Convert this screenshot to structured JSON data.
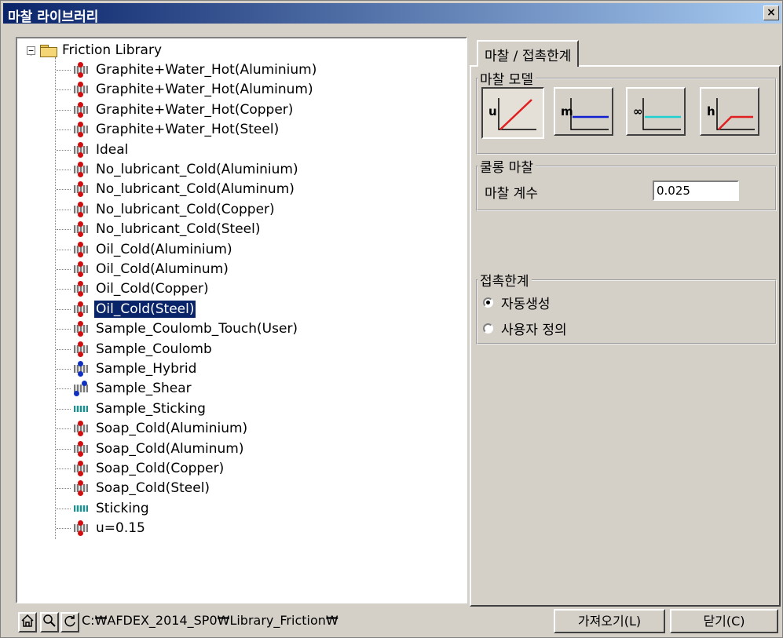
{
  "window": {
    "title": "마찰 라이브러리",
    "close_glyph": "×"
  },
  "tree": {
    "root_label": "Friction Library",
    "expander_glyph": "−",
    "items": [
      {
        "label": "Graphite+Water_Hot(Aluminium)",
        "icon": "red-grid-icon"
      },
      {
        "label": "Graphite+Water_Hot(Aluminum)",
        "icon": "red-grid-icon"
      },
      {
        "label": "Graphite+Water_Hot(Copper)",
        "icon": "red-grid-icon"
      },
      {
        "label": "Graphite+Water_Hot(Steel)",
        "icon": "red-grid-icon"
      },
      {
        "label": "Ideal",
        "icon": "red-grid-icon"
      },
      {
        "label": "No_lubricant_Cold(Aluminium)",
        "icon": "red-grid-icon"
      },
      {
        "label": "No_lubricant_Cold(Aluminum)",
        "icon": "red-grid-icon"
      },
      {
        "label": "No_lubricant_Cold(Copper)",
        "icon": "red-grid-icon"
      },
      {
        "label": "No_lubricant_Cold(Steel)",
        "icon": "red-grid-icon"
      },
      {
        "label": "Oil_Cold(Aluminium)",
        "icon": "red-grid-icon"
      },
      {
        "label": "Oil_Cold(Aluminum)",
        "icon": "red-grid-icon"
      },
      {
        "label": "Oil_Cold(Copper)",
        "icon": "red-grid-icon"
      },
      {
        "label": "Oil_Cold(Steel)",
        "icon": "red-grid-icon",
        "selected": true
      },
      {
        "label": "Sample_Coulomb_Touch(User)",
        "icon": "red-grid-icon"
      },
      {
        "label": "Sample_Coulomb",
        "icon": "red-grid-icon"
      },
      {
        "label": "Sample_Hybrid",
        "icon": "hybrid-grid-icon"
      },
      {
        "label": "Sample_Shear",
        "icon": "shear-grid-icon"
      },
      {
        "label": "Sample_Sticking",
        "icon": "sticking-grid-icon"
      },
      {
        "label": "Soap_Cold(Aluminium)",
        "icon": "red-grid-icon"
      },
      {
        "label": "Soap_Cold(Aluminum)",
        "icon": "red-grid-icon"
      },
      {
        "label": "Soap_Cold(Copper)",
        "icon": "red-grid-icon"
      },
      {
        "label": "Soap_Cold(Steel)",
        "icon": "red-grid-icon"
      },
      {
        "label": "Sticking",
        "icon": "sticking-grid-icon"
      },
      {
        "label": "u=0.15",
        "icon": "red-grid-icon"
      }
    ]
  },
  "tab": {
    "label": "마찰 / 접촉한계"
  },
  "friction_model": {
    "legend": "마찰 모델",
    "buttons": [
      {
        "label": "u",
        "line_color": "#e02020",
        "active": true
      },
      {
        "label": "m",
        "line_color": "#1020d0",
        "active": false
      },
      {
        "label": "∞",
        "line_color": "#20d0d0",
        "active": false
      },
      {
        "label": "h",
        "line_color": "#e02020",
        "active": false
      }
    ]
  },
  "coulomb": {
    "legend": "쿨롱 마찰",
    "coef_label": "마찰 계수",
    "coef_value": "0.025"
  },
  "contact": {
    "legend": "접촉한계",
    "options": [
      {
        "label": "자동생성",
        "checked": true
      },
      {
        "label": "사용자 정의",
        "checked": false
      }
    ]
  },
  "status": {
    "path": "C:₩AFDEX_2014_SP0₩Library_Friction₩"
  },
  "buttons": {
    "import": "가져오기(L)",
    "close": "닫기(C)"
  }
}
